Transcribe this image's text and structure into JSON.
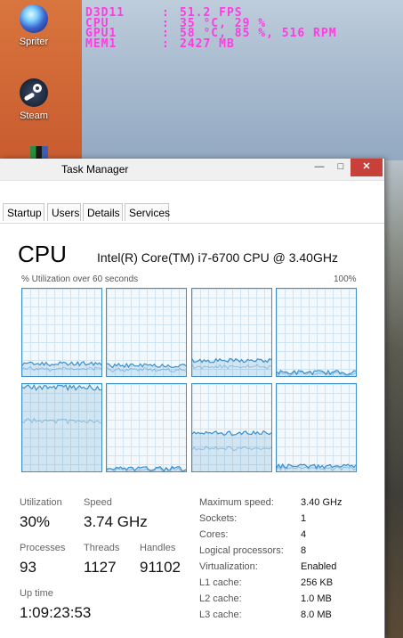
{
  "desktop": {
    "icons": [
      {
        "label": "Spriter",
        "icon": "spriter-icon"
      },
      {
        "label": "Steam",
        "icon": "steam-icon"
      }
    ]
  },
  "osd": {
    "rows": [
      {
        "key": "D3D11",
        "value": "51.2 FPS"
      },
      {
        "key": "CPU",
        "value": "35 °C, 29 %"
      },
      {
        "key": "GPU1",
        "value": "58 °C, 85 %, 516 RPM"
      },
      {
        "key": "MEM1",
        "value": "2427 MB"
      }
    ],
    "separator": ":",
    "color": "#ff3ce0"
  },
  "window": {
    "title": "Task Manager",
    "controls": {
      "minimize": "—",
      "maximize": "□",
      "close": "✕"
    },
    "tabs": [
      "Startup",
      "Users",
      "Details",
      "Services"
    ]
  },
  "cpu": {
    "heading": "CPU",
    "model": "Intel(R) Core(TM) i7-6700 CPU @ 3.40GHz",
    "util_label": "% Utilization over 60 seconds",
    "util_max": "100%",
    "graph_color": "#3c8fc9",
    "core_levels": [
      0.14,
      0.12,
      0.18,
      0.04,
      0.96,
      0.03,
      0.44,
      0.06
    ]
  },
  "stats": {
    "utilization": {
      "label": "Utilization",
      "value": "30%"
    },
    "speed": {
      "label": "Speed",
      "value": "3.74 GHz"
    },
    "processes": {
      "label": "Processes",
      "value": "93"
    },
    "threads": {
      "label": "Threads",
      "value": "1127"
    },
    "handles": {
      "label": "Handles",
      "value": "91102"
    },
    "uptime": {
      "label": "Up time",
      "value": "1:09:23:53"
    }
  },
  "details": [
    {
      "key": "Maximum speed:",
      "value": "3.40 GHz"
    },
    {
      "key": "Sockets:",
      "value": "1"
    },
    {
      "key": "Cores:",
      "value": "4"
    },
    {
      "key": "Logical processors:",
      "value": "8"
    },
    {
      "key": "Virtualization:",
      "value": "Enabled"
    },
    {
      "key": "L1 cache:",
      "value": "256 KB"
    },
    {
      "key": "L2 cache:",
      "value": "1.0 MB"
    },
    {
      "key": "L3 cache:",
      "value": "8.0 MB"
    }
  ]
}
